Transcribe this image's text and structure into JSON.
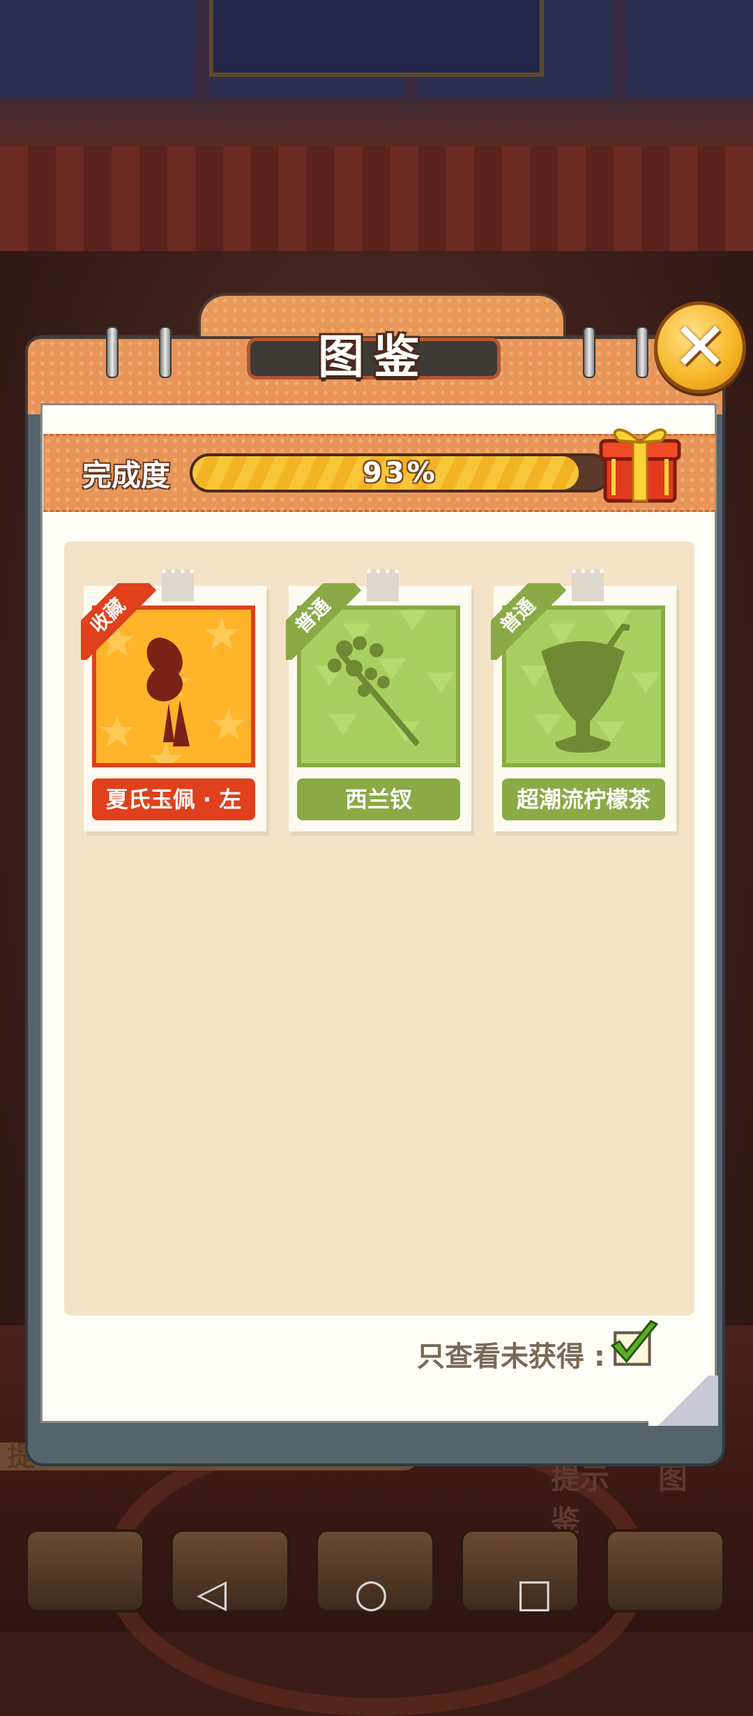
{
  "dialog": {
    "title": "图鉴",
    "close_icon": "close-icon",
    "progress": {
      "label": "完成度",
      "value_text": "93%",
      "value": 0.93,
      "reward_icon": "gift-icon"
    },
    "cards": [
      {
        "name": "夏氏玉佩 · 左",
        "rarity": "收藏",
        "theme": "red",
        "icon": "jade-pendant-icon"
      },
      {
        "name": "西兰钗",
        "rarity": "普通",
        "theme": "green",
        "icon": "hairpin-icon"
      },
      {
        "name": "超潮流柠檬茶",
        "rarity": "普通",
        "theme": "green",
        "icon": "lemon-tea-icon"
      }
    ],
    "filter": {
      "label": "只查看未获得 :",
      "checked": true
    }
  },
  "background_tabs": [
    "提示",
    "图鉴"
  ],
  "background_strip_text": "提",
  "navbar": {
    "back": "◁",
    "home": "○",
    "recents": "□"
  },
  "colors": {
    "collect_red": "#e0401c",
    "common_green": "#8aaa46",
    "header_orange": "#e8955a"
  }
}
